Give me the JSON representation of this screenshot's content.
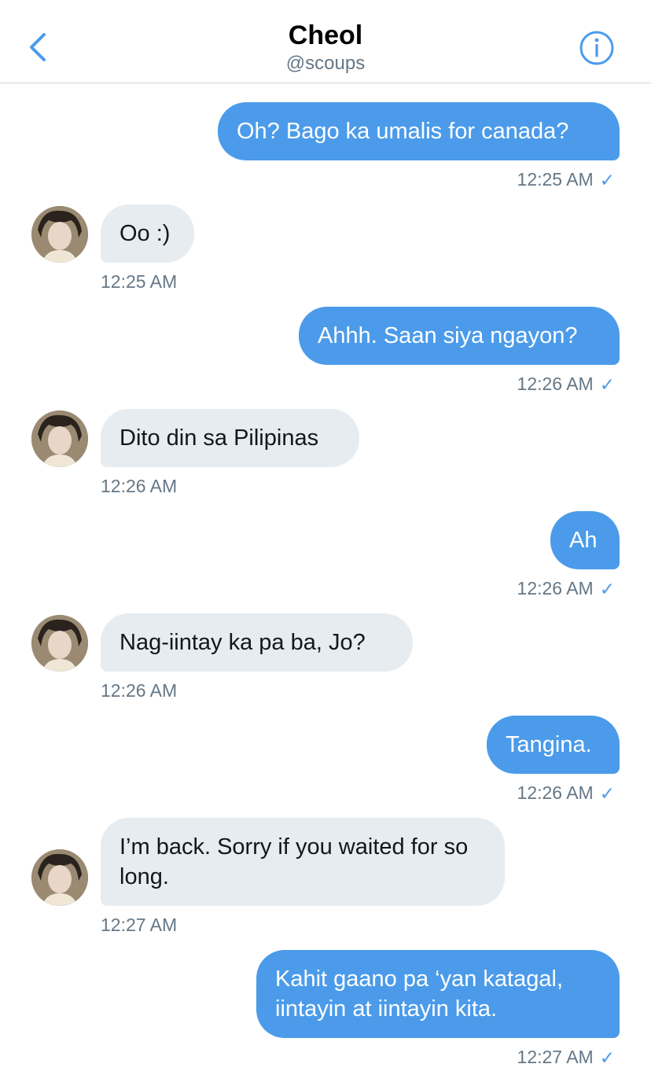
{
  "header": {
    "title": "Cheol",
    "handle": "@scoups"
  },
  "colors": {
    "outgoing_bubble": "#4b9bea",
    "incoming_bubble": "#e6ecf0",
    "timestamp": "#657786",
    "accent": "#4b9bea"
  },
  "icons": {
    "back": "chevron-left-icon",
    "info": "info-icon",
    "read": "checkmark-icon"
  },
  "messages": [
    {
      "direction": "outgoing",
      "text": "Oh? Bago ka umalis for canada?",
      "time": "12:25 AM",
      "read": true
    },
    {
      "direction": "incoming",
      "text": "Oo :)",
      "time": "12:25 AM"
    },
    {
      "direction": "outgoing",
      "text": "Ahhh. Saan siya ngayon?",
      "time": "12:26 AM",
      "read": true
    },
    {
      "direction": "incoming",
      "text": "Dito din sa Pilipinas",
      "time": "12:26 AM"
    },
    {
      "direction": "outgoing",
      "text": "Ah",
      "time": "12:26 AM",
      "read": true
    },
    {
      "direction": "incoming",
      "text": "Nag-iintay ka pa ba, Jo?",
      "time": "12:26 AM"
    },
    {
      "direction": "outgoing",
      "text": "Tangina.",
      "time": "12:26 AM",
      "read": true
    },
    {
      "direction": "incoming",
      "text": "I’m back. Sorry if you waited for so long.",
      "time": "12:27 AM"
    },
    {
      "direction": "outgoing",
      "text": "Kahit gaano pa ‘yan katagal, iintayin at iintayin kita.",
      "time": "12:27 AM",
      "read": true
    }
  ]
}
